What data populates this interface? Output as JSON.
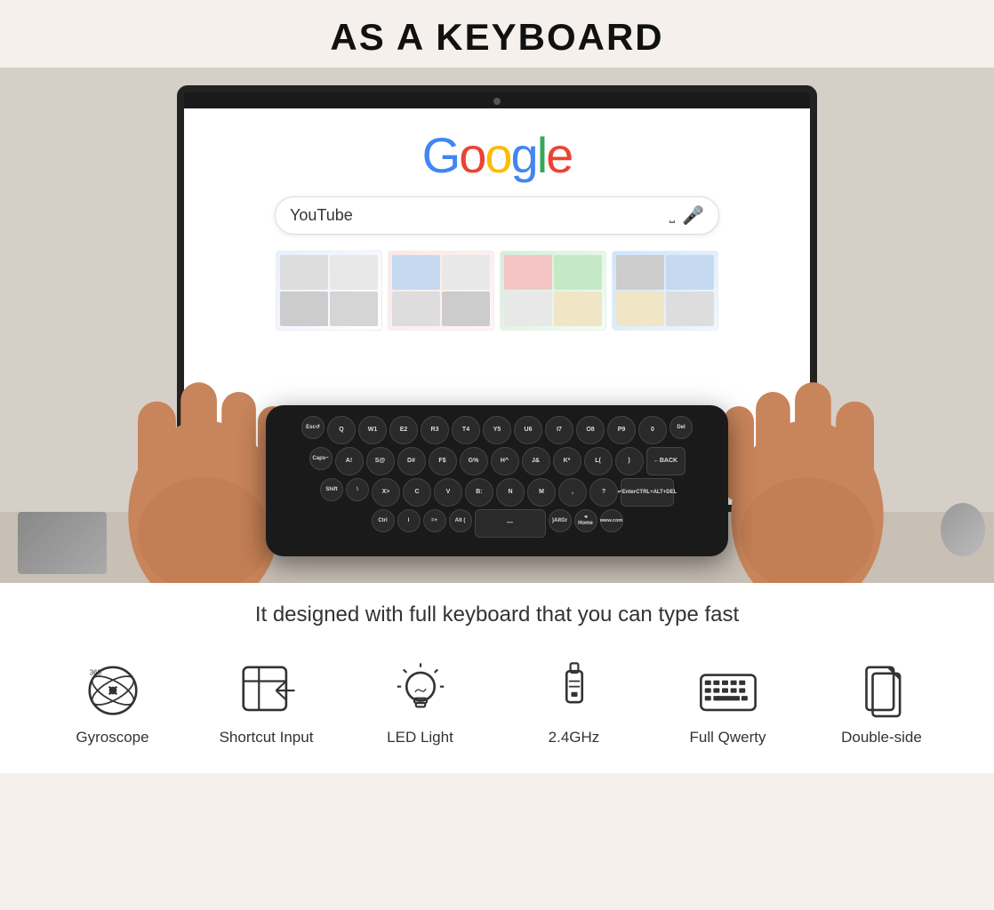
{
  "header": {
    "title": "AS A KEYBOARD"
  },
  "monitor": {
    "google_logo": "Google",
    "search_text": "YouTube",
    "camera_alt": "webcam"
  },
  "description": {
    "text": "It designed with full keyboard that you can type fast"
  },
  "features": [
    {
      "id": "gyroscope",
      "label": "Gyroscope",
      "icon": "gyroscope-icon"
    },
    {
      "id": "shortcut-input",
      "label": "Shortcut Input",
      "icon": "shortcut-icon"
    },
    {
      "id": "led-light",
      "label": "LED Light",
      "icon": "led-icon"
    },
    {
      "id": "2ghz",
      "label": "2.4GHz",
      "icon": "wifi-icon"
    },
    {
      "id": "full-qwerty",
      "label": "Full Qwerty",
      "icon": "keyboard-icon"
    },
    {
      "id": "double-side",
      "label": "Double-side",
      "icon": "double-side-icon"
    }
  ],
  "keyboard": {
    "rows": [
      [
        "Esc↺",
        "Q",
        "W1",
        "E2",
        "R3",
        "T4",
        "Y5",
        "U6",
        "I7",
        "O8",
        "P9",
        "0",
        "Del"
      ],
      [
        "Caps~",
        "A!",
        "S@",
        "D#",
        "F$",
        "G%",
        "H^",
        "J&",
        "K*",
        "L(",
        ")",
        "+BACK"
      ],
      [
        "Shift",
        "\\",
        "X>",
        "C",
        "V",
        "B:",
        "N",
        "M",
        "?",
        "↵Enter CTRL+ALT+DEL"
      ],
      [
        "Ctrl",
        "I",
        "=+",
        "Alt (",
        "—",
        "} AltGr",
        "◄ Home",
        "www.com"
      ]
    ]
  }
}
